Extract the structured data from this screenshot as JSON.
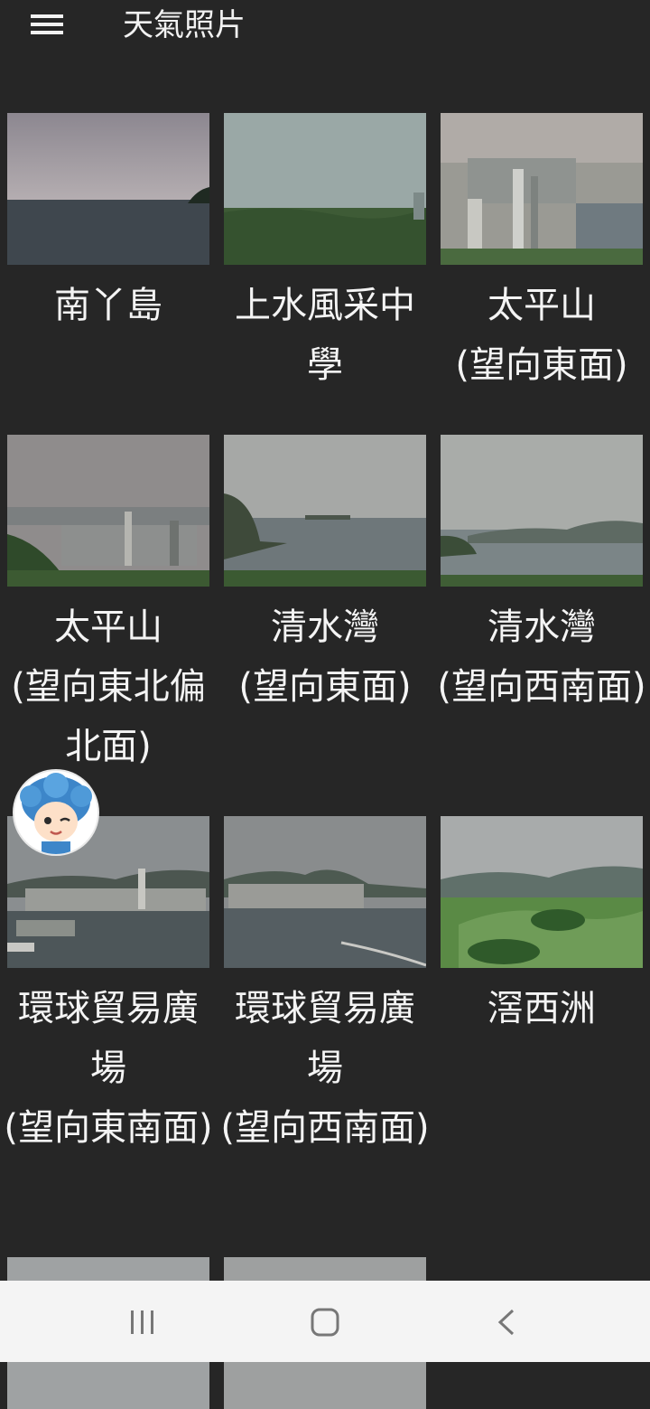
{
  "header": {
    "title": "天氣照片",
    "menu_icon": "hamburger-menu-icon"
  },
  "photos": [
    {
      "caption": "南丫島"
    },
    {
      "caption": "上水風采中學"
    },
    {
      "caption": "太平山\n(望向東面)"
    },
    {
      "caption": "太平山\n(望向東北偏北面)"
    },
    {
      "caption": "清水灣\n(望向東面)"
    },
    {
      "caption": "清水灣\n(望向西南面)"
    },
    {
      "caption": "環球貿易廣場\n(望向東南面)"
    },
    {
      "caption": "環球貿易廣場\n(望向西南面)"
    },
    {
      "caption": "滘西洲"
    }
  ],
  "floating_avatar": {
    "icon": "cartoon-avatar-icon"
  },
  "navbar": {
    "icons": [
      "recent-apps-icon",
      "home-icon",
      "back-icon"
    ]
  },
  "colors": {
    "background": "#262626",
    "navbar": "#f4f4f4",
    "text": "#f4f4f4"
  }
}
